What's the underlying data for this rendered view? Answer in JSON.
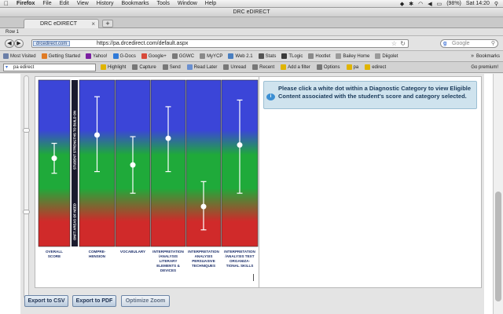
{
  "menubar": {
    "app": "Firefox",
    "items": [
      "File",
      "Edit",
      "View",
      "History",
      "Bookmarks",
      "Tools",
      "Window",
      "Help"
    ],
    "battery": "(98%)",
    "clock": "Sat 14:20"
  },
  "window": {
    "title": "DRC eDIRECT"
  },
  "tabs": {
    "active_label": "DRC eDIRECT",
    "new_tab": "+"
  },
  "row_label": "Row 1",
  "navbar": {
    "site_identity": "drcedirect.com",
    "url": "https://pa.drcedirect.com/default.aspx",
    "search_placeholder": "Google"
  },
  "bookmarks": {
    "items": [
      {
        "label": "Most Visited",
        "color": "#6b7fa8"
      },
      {
        "label": "Getting Started",
        "color": "#e07b24"
      },
      {
        "label": "Yahoo!",
        "color": "#7b1fa2"
      },
      {
        "label": "G-Docs",
        "color": "#2f7ad8"
      },
      {
        "label": "Google+",
        "color": "#d84a3a"
      },
      {
        "label": "GGWC",
        "color": "#7a7a7a"
      },
      {
        "label": "MyYCP",
        "color": "#8a8a8a"
      },
      {
        "label": "Web 2.1",
        "color": "#4a7fc0"
      },
      {
        "label": "Stats",
        "color": "#555555"
      },
      {
        "label": "TLogic",
        "color": "#3a3a3a"
      },
      {
        "label": "Hootlet",
        "color": "#8a8a8a"
      },
      {
        "label": "Bailey Home",
        "color": "#9a9a9a"
      },
      {
        "label": "Diigolet",
        "color": "#9a9a9a"
      }
    ],
    "overflow": "»",
    "menu_label": "Bookmarks"
  },
  "addonbar": {
    "search_value": "pa edirect",
    "items": [
      {
        "label": "Highlight",
        "color": "#e0b400"
      },
      {
        "label": "Capture",
        "color": "#777777"
      },
      {
        "label": "Send",
        "color": "#777777"
      },
      {
        "label": "Read Later",
        "color": "#6a8fd0"
      },
      {
        "label": "Unread",
        "color": "#777777"
      },
      {
        "label": "Recent",
        "color": "#777777"
      },
      {
        "label": "Add a filter",
        "color": "#e0b400"
      },
      {
        "label": "Options",
        "color": "#777777"
      },
      {
        "label": "pa",
        "color": "#e0b400"
      },
      {
        "label": "edirect",
        "color": "#e0b400"
      }
    ],
    "premium": "Go premium!"
  },
  "chart_data": {
    "type": "scatter",
    "title": "",
    "side_labels": {
      "top": "STUDENT STRENGTHS TO BUILD ON",
      "bottom": "ONFT AREAS OF NEED"
    },
    "categories": [
      {
        "label": "OVERALL SCORE",
        "lines": [
          "OVERALL",
          "SCORE"
        ],
        "value": 0.53,
        "low": 0.44,
        "high": 0.62
      },
      {
        "label": "COMPRE-HENSION",
        "lines": [
          "COMPRE-",
          "HENSION"
        ],
        "value": 0.67,
        "low": 0.45,
        "high": 0.9
      },
      {
        "label": "VOCABULARY",
        "lines": [
          "VOCABULARY"
        ],
        "value": 0.49,
        "low": 0.32,
        "high": 0.66
      },
      {
        "label": "INTERPRETATION /ANALYSIS LITERARY ELEMENTS & DEVICES",
        "lines": [
          "INTERPRETATION",
          "/ANALYSIS",
          "LITERARY",
          "ELEMENTS &",
          "DEVICES"
        ],
        "value": 0.65,
        "low": 0.45,
        "high": 0.84
      },
      {
        "label": "INTERPRETATION ANALYSIS PERSUASIVE TECHNIQUES",
        "lines": [
          "INTERPRETATION",
          "ANALYSIS",
          "PERSUASIVE",
          "TECHNIQUES"
        ],
        "value": 0.24,
        "low": 0.1,
        "high": 0.39
      },
      {
        "label": "INTERPRETATION /ANALYSIS TEXT ORGANIZA-TIONAL SKILLS",
        "lines": [
          "INTERPRETATION",
          "/ANALYSIS TEXT",
          "ORGANIZA-",
          "TIONAL SKILLS"
        ],
        "value": 0.61,
        "low": 0.32,
        "high": 0.88
      }
    ],
    "ylim": [
      0,
      1
    ],
    "gradient_colors": [
      "#3b45d8",
      "#1faa3a",
      "#d02a2a"
    ]
  },
  "info": {
    "message": "Please click a white dot within a Diagnostic Category to view Eligible Content associated with the student's score and category selected."
  },
  "buttons": {
    "export_csv": "Export to CSV",
    "export_pdf": "Export to PDF",
    "optimize_zoom": "Optimize Zoom"
  }
}
